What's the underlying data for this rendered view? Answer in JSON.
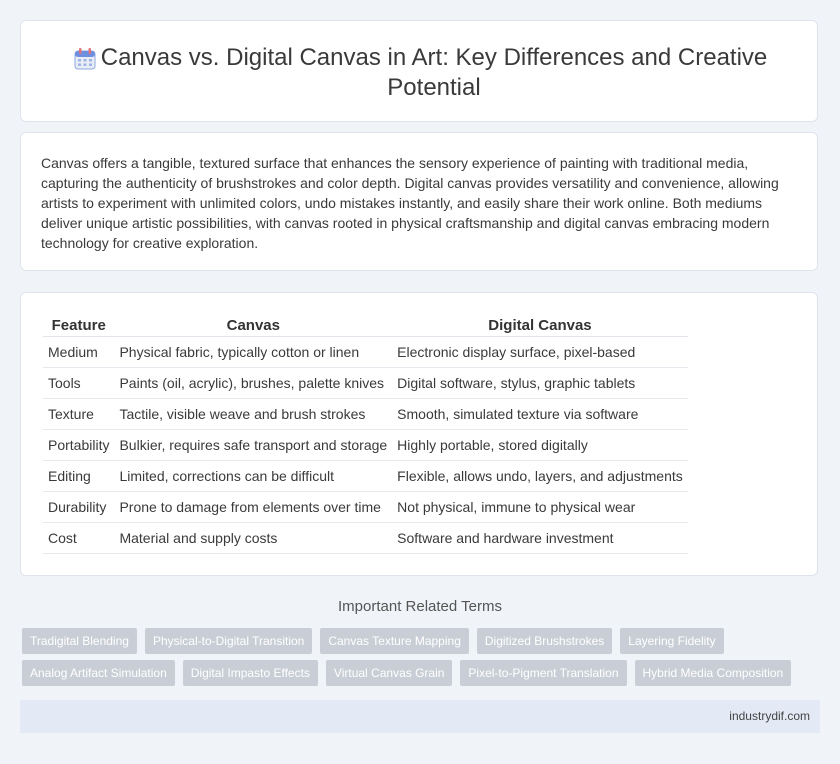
{
  "header": {
    "title": "Canvas vs. Digital Canvas in Art: Key Differences and Creative Potential",
    "icon": "calendar-icon"
  },
  "intro": "Canvas offers a tangible, textured surface that enhances the sensory experience of painting with traditional media, capturing the authenticity of brushstrokes and color depth. Digital canvas provides versatility and convenience, allowing artists to experiment with unlimited colors, undo mistakes instantly, and easily share their work online. Both mediums deliver unique artistic possibilities, with canvas rooted in physical craftsmanship and digital canvas embracing modern technology for creative exploration.",
  "table": {
    "headers": [
      "Feature",
      "Canvas",
      "Digital Canvas"
    ],
    "rows": [
      [
        "Medium",
        "Physical fabric, typically cotton or linen",
        "Electronic display surface, pixel-based"
      ],
      [
        "Tools",
        "Paints (oil, acrylic), brushes, palette knives",
        "Digital software, stylus, graphic tablets"
      ],
      [
        "Texture",
        "Tactile, visible weave and brush strokes",
        "Smooth, simulated texture via software"
      ],
      [
        "Portability",
        "Bulkier, requires safe transport and storage",
        "Highly portable, stored digitally"
      ],
      [
        "Editing",
        "Limited, corrections can be difficult",
        "Flexible, allows undo, layers, and adjustments"
      ],
      [
        "Durability",
        "Prone to damage from elements over time",
        "Not physical, immune to physical wear"
      ],
      [
        "Cost",
        "Material and supply costs",
        "Software and hardware investment"
      ]
    ]
  },
  "related": {
    "heading": "Important Related Terms",
    "row1": [
      "Tradigital Blending",
      "Physical-to-Digital Transition",
      "Canvas Texture Mapping",
      "Digitized Brushstrokes",
      "Layering Fidelity"
    ],
    "row2": [
      "Analog Artifact Simulation",
      "Digital Impasto Effects",
      "Virtual Canvas Grain",
      "Pixel-to-Pigment Translation",
      "Hybrid Media Composition"
    ]
  },
  "footer": {
    "site": "industrydif.com"
  }
}
